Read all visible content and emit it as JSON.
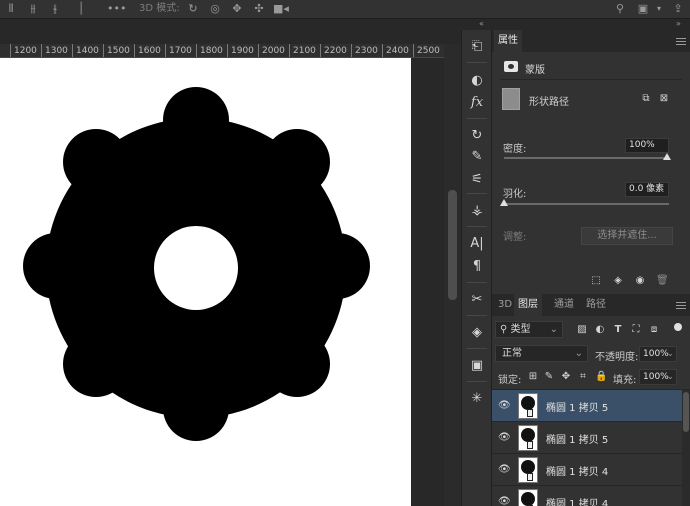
{
  "topbar": {
    "mode_label": "3D 模式:"
  },
  "ruler": {
    "labels": [
      "1200",
      "1300",
      "1400",
      "1500",
      "1600",
      "1700",
      "1800",
      "1900",
      "2000",
      "2100",
      "2200",
      "2300",
      "2400",
      "2500"
    ]
  },
  "properties_panel": {
    "tab_label": "属性",
    "section_label": "蒙版",
    "shape_path_label": "形状路径",
    "density_label": "密度:",
    "density_value": "100%",
    "density_level": 1.0,
    "feather_label": "羽化:",
    "feather_value": "0.0 像素",
    "feather_level": 0.0,
    "adjust_label": "调整:",
    "select_and_mask_button": "选择并遮住..."
  },
  "layers_panel": {
    "tabs": [
      "3D",
      "图层",
      "通道",
      "路径"
    ],
    "active_tab": "图层",
    "filter_kind": "类型",
    "blend_mode": "正常",
    "opacity_label": "不透明度:",
    "opacity_value": "100%",
    "lock_label": "锁定:",
    "fill_label": "填充:",
    "fill_value": "100%",
    "layers": [
      {
        "name": "椭圆 1 拷贝 5",
        "selected": true
      },
      {
        "name": "椭圆 1 拷贝 5",
        "selected": false
      },
      {
        "name": "椭圆 1 拷贝 4",
        "selected": false
      },
      {
        "name": "椭圆 1 拷贝 4",
        "selected": false
      }
    ]
  },
  "colors": {
    "selection": "#3a5068",
    "canvas_bg": "#ffffff",
    "shape_fill": "#000000"
  }
}
